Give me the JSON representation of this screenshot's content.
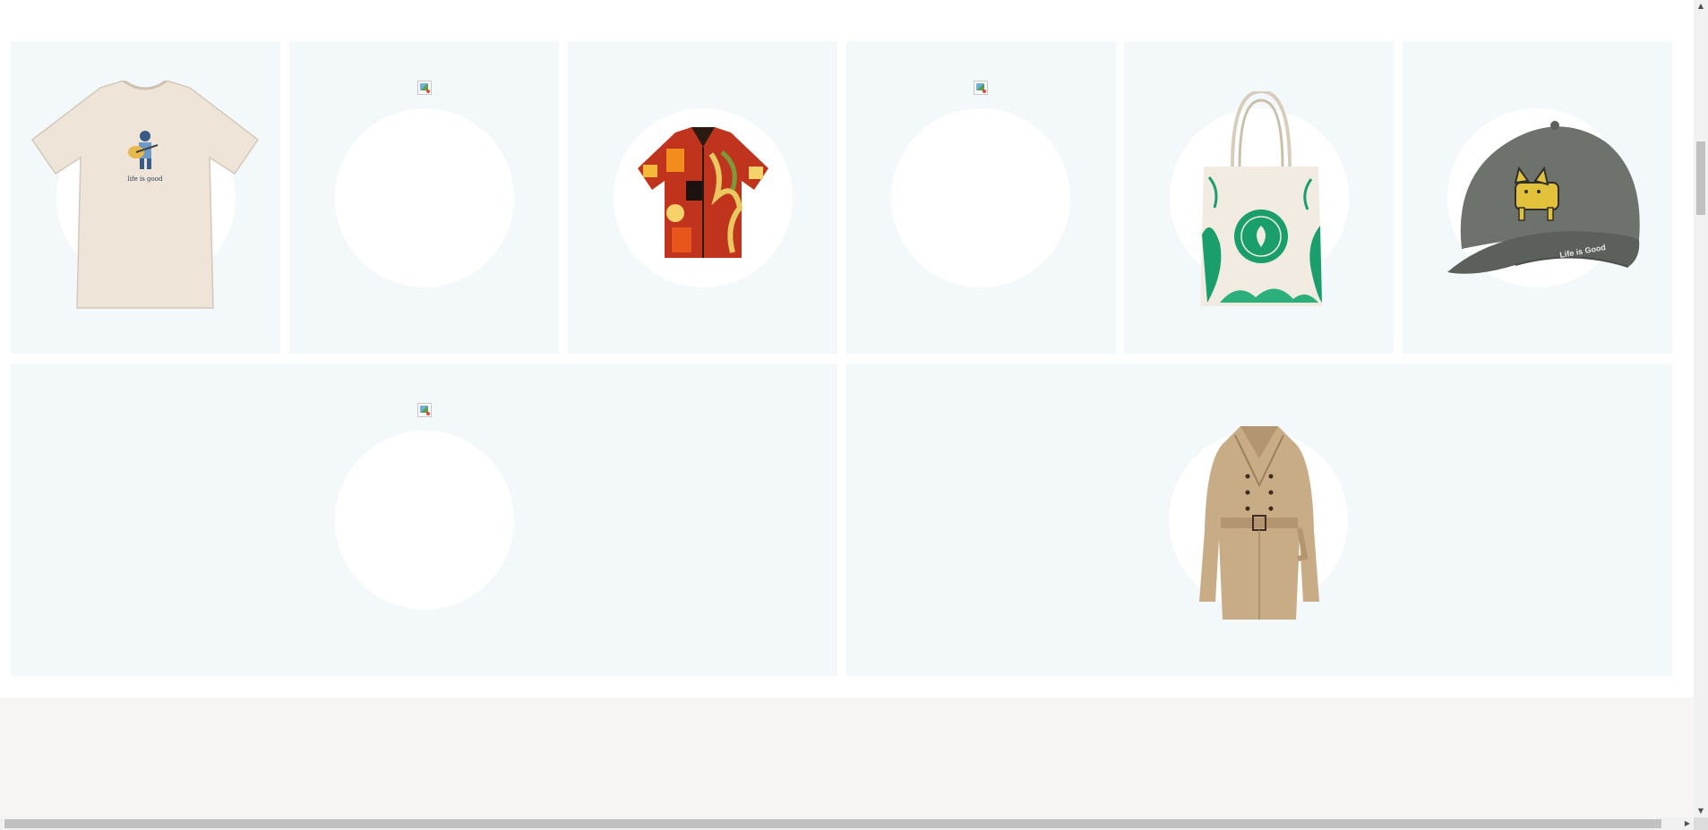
{
  "products": [
    {
      "image": "tshirt-guitar-image",
      "image_loaded": true,
      "print_text": "life is good"
    },
    {
      "image": "product-image",
      "image_loaded": false
    },
    {
      "image": "hawaiian-shirt-image",
      "image_loaded": true
    },
    {
      "image": "product-image",
      "image_loaded": false
    },
    {
      "image": "tote-bag-image",
      "image_loaded": true
    },
    {
      "image": "cap-cat-image",
      "image_loaded": true,
      "print_text": "Life is Good"
    },
    {
      "image": "product-image",
      "image_loaded": false
    },
    {
      "image": "trench-coat-image",
      "image_loaded": true
    }
  ],
  "colors": {
    "card_background": "#f3f8fb",
    "footer_background": "#f8f4f4",
    "tote_accent": "#1a9e6c"
  },
  "scrollbar": {
    "up_glyph": "▲",
    "down_glyph": "▼",
    "left_glyph": "◀",
    "right_glyph": "▶"
  }
}
